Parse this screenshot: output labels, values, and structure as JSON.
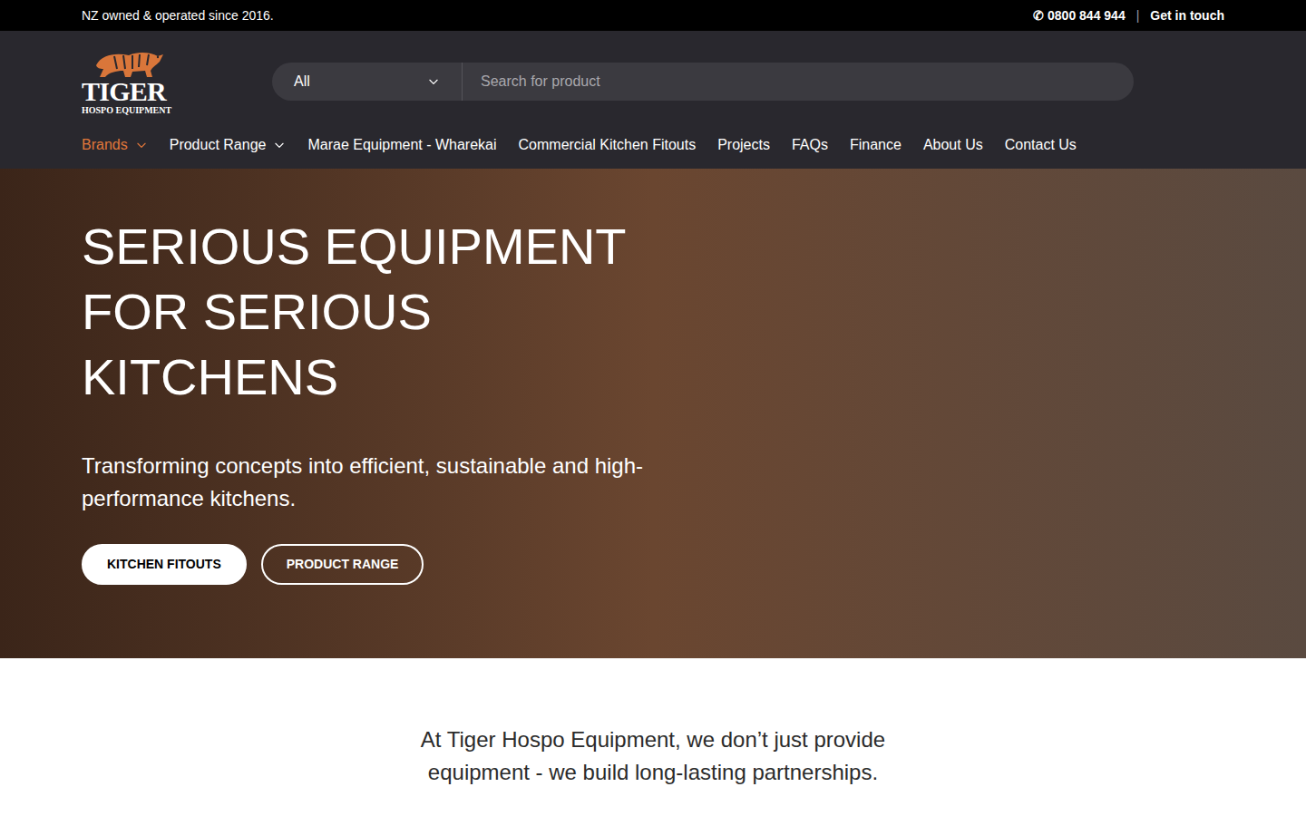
{
  "top_bar": {
    "tagline": "NZ owned & operated since 2016.",
    "phone_icon": "✆",
    "phone": "0800 844 944",
    "separator": "|",
    "contact_link": "Get in touch"
  },
  "logo": {
    "name": "TIGER",
    "subtitle": "HOSPO EQUIPMENT"
  },
  "search": {
    "category": "All",
    "placeholder": "Search for product"
  },
  "nav": [
    {
      "label": "Brands",
      "selected": true,
      "has_menu": true
    },
    {
      "label": "Product Range",
      "selected": false,
      "has_menu": true
    },
    {
      "label": "Marae Equipment - Wharekai",
      "selected": false,
      "has_menu": false
    },
    {
      "label": "Commercial Kitchen Fitouts",
      "selected": false,
      "has_menu": false
    },
    {
      "label": "Projects",
      "selected": false,
      "has_menu": false
    },
    {
      "label": "FAQs",
      "selected": false,
      "has_menu": false
    },
    {
      "label": "Finance",
      "selected": false,
      "has_menu": false
    },
    {
      "label": "About Us",
      "selected": false,
      "has_menu": false
    },
    {
      "label": "Contact Us",
      "selected": false,
      "has_menu": false
    }
  ],
  "hero": {
    "heading": [
      "SERIOUS EQUIPMENT",
      "FOR SERIOUS",
      "KITCHENS"
    ],
    "subtitle": "Transforming concepts into efficient, sustainable and high-performance kitchens.",
    "buttons": [
      {
        "label": "KITCHEN FITOUTS",
        "kind": "filled"
      },
      {
        "label": "PRODUCT RANGE",
        "kind": "outline"
      }
    ]
  },
  "intro": "At Tiger Hospo Equipment, we don’t just provide equipment - we build long-lasting partnerships."
}
